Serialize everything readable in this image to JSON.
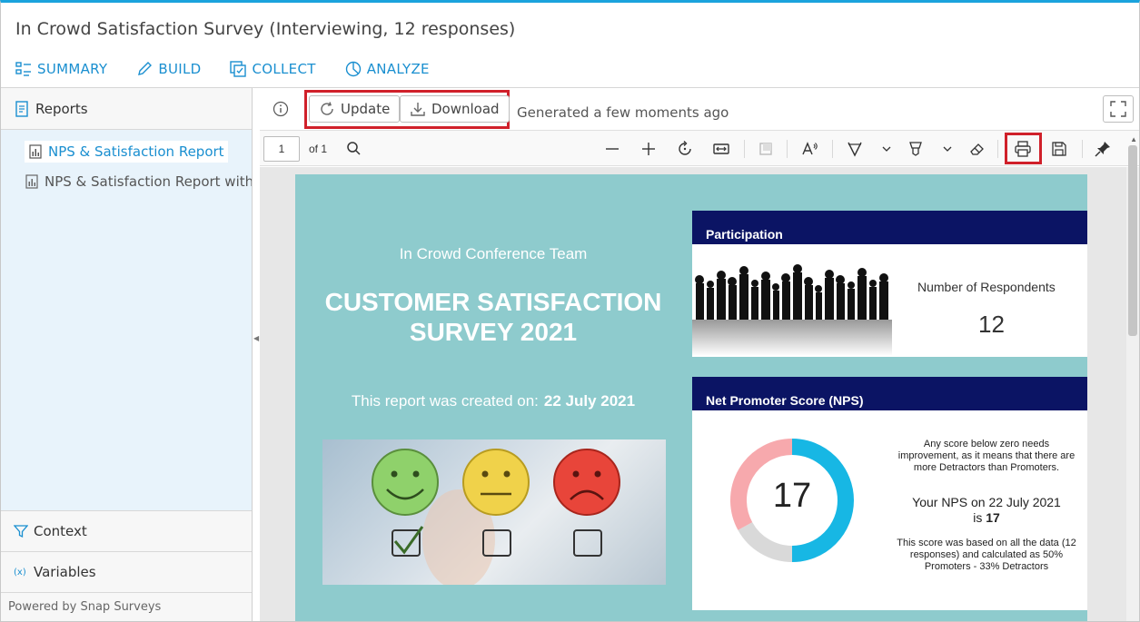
{
  "window": {
    "title": "In Crowd Satisfaction Survey (Interviewing, 12 responses)"
  },
  "nav": {
    "summary": "SUMMARY",
    "build": "BUILD",
    "collect": "COLLECT",
    "analyze": "ANALYZE"
  },
  "sidebar": {
    "header": "Reports",
    "items": [
      {
        "label": "NPS & Satisfaction Report"
      },
      {
        "label": "NPS & Satisfaction Report with ratings"
      }
    ],
    "context": "Context",
    "variables": "Variables",
    "powered": "Powered by Snap Surveys"
  },
  "toolbar": {
    "update_label": "Update",
    "download_label": "Download",
    "generated": "Generated a few moments ago"
  },
  "pdf": {
    "page_current": "1",
    "page_of": "of 1"
  },
  "report": {
    "team": "In Crowd Conference Team",
    "title_line1": "CUSTOMER SATISFACTION",
    "title_line2": "SURVEY 2021",
    "created_prefix": "This report was created on:",
    "created_date": "22 July 2021",
    "participation": {
      "header": "Participation",
      "label": "Number of Respondents",
      "value": "12"
    },
    "nps": {
      "header": "Net Promoter Score (NPS)",
      "score": "17",
      "note1": "Any score below zero needs improvement, as it means that there are more Detractors than Promoters.",
      "your_nps_line1": "Your NPS on 22 July 2021",
      "your_nps_is": "is",
      "your_nps_value": "17",
      "note2": "This score was based on all the data (12 responses) and calculated as 50% Promoters - 33% Detractors",
      "promoters_pct": 50,
      "detractors_pct": 33,
      "passives_pct": 17,
      "colors": {
        "promoters": "#17b7e4",
        "detractors": "#f7a9ad",
        "passives": "#d9d9d9"
      }
    }
  },
  "colors": {
    "accent": "#1a8fd0",
    "highlight": "#d0202a",
    "card_header": "#0b1464",
    "page_bg": "#8ecbcd"
  }
}
